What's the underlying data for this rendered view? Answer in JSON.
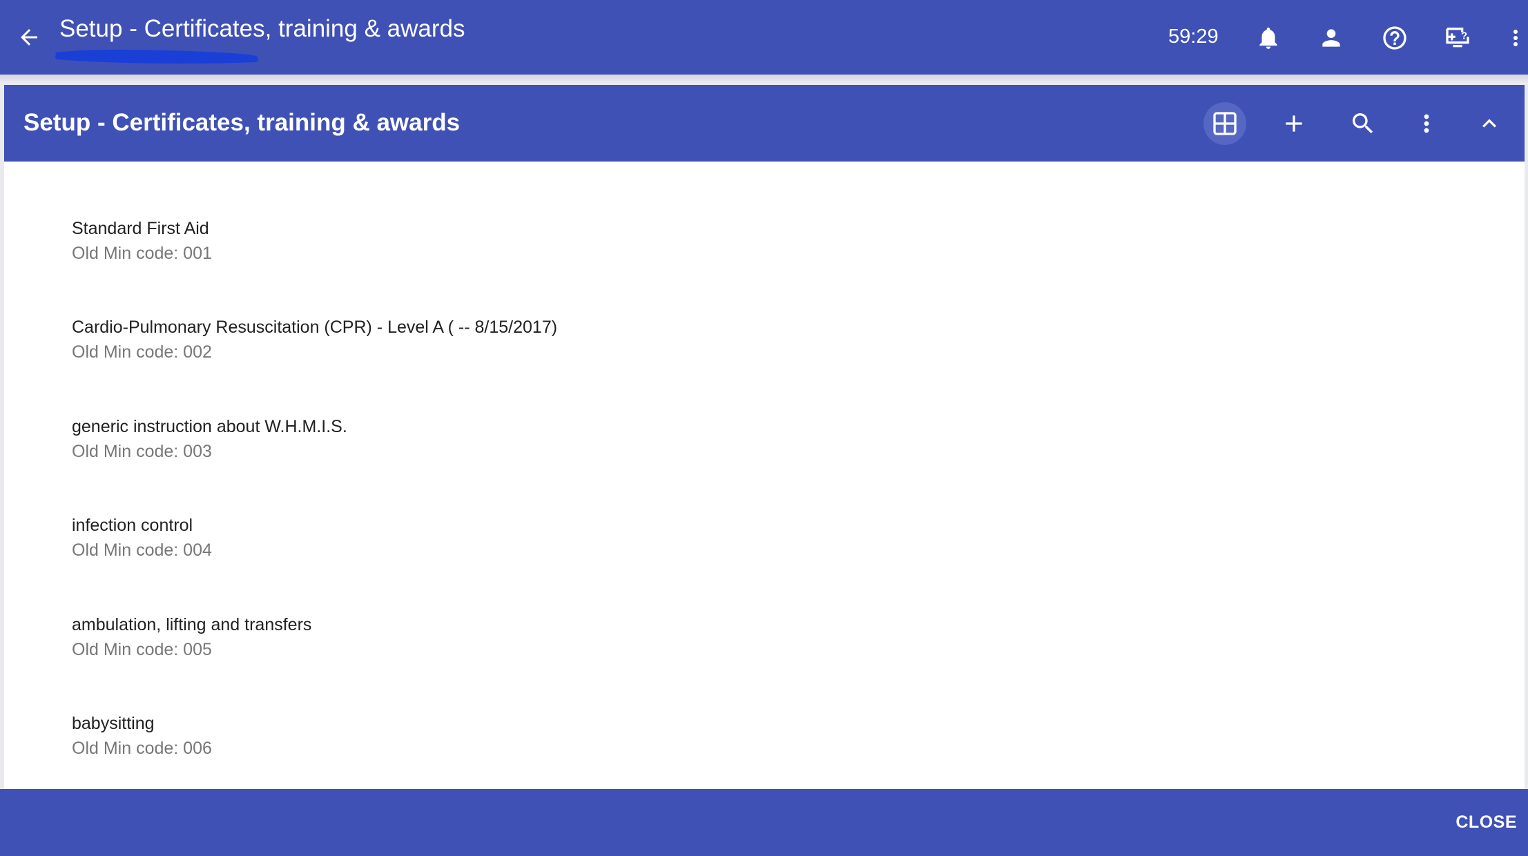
{
  "header": {
    "title": "Setup - Certificates, training & awards",
    "timer": "59:29"
  },
  "panel": {
    "title": "Setup - Certificates, training & awards"
  },
  "items": [
    {
      "name": "Standard First Aid",
      "code": "Old Min code: 001"
    },
    {
      "name": "Cardio-Pulmonary Resuscitation (CPR) - Level A ( -- 8/15/2017)",
      "code": "Old Min code: 002"
    },
    {
      "name": "generic instruction about W.H.M.I.S.",
      "code": "Old Min code: 003"
    },
    {
      "name": "infection control",
      "code": "Old Min code: 004"
    },
    {
      "name": "ambulation, lifting and transfers",
      "code": "Old Min code: 005"
    },
    {
      "name": "babysitting",
      "code": "Old Min code: 006"
    }
  ],
  "footer": {
    "close_label": "CLOSE"
  },
  "colors": {
    "primary": "#3f51b5",
    "scribble": "#1a3fd6",
    "text": "#212121",
    "subtext": "#777777"
  },
  "icons": [
    "arrow-left-icon",
    "bell-icon",
    "person-icon",
    "help-icon",
    "remote-support-icon",
    "more-vert-icon",
    "grid-view-icon",
    "add-icon",
    "search-icon",
    "chevron-up-icon"
  ]
}
